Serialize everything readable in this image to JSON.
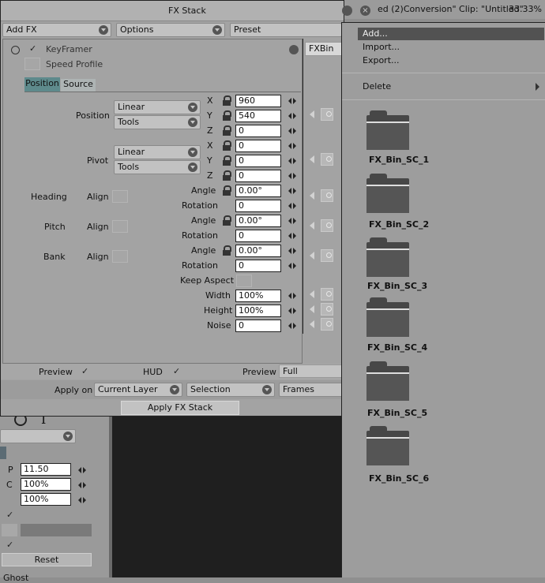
{
  "fx_stack": {
    "title": "FX Stack",
    "toolbar": {
      "add_fx": "Add FX",
      "options": "Options",
      "preset": "Preset"
    },
    "keyframer": {
      "name": "KeyFramer",
      "speed_profile": "Speed Profile",
      "tabs": [
        "Position",
        "Source"
      ],
      "position": {
        "label": "Position",
        "interp": "Linear",
        "tools": "Tools",
        "x": "960",
        "y": "540",
        "z": "0"
      },
      "pivot": {
        "label": "Pivot",
        "interp": "Linear",
        "tools": "Tools",
        "x": "0",
        "y": "0",
        "z": "0"
      },
      "axis": {
        "x": "X",
        "y": "Y",
        "z": "Z"
      },
      "heading": {
        "label": "Heading",
        "align": "Align",
        "angle": "0.00°",
        "rotation": "0"
      },
      "pitch": {
        "label": "Pitch",
        "align": "Align",
        "angle": "0.00°",
        "rotation": "0"
      },
      "bank": {
        "label": "Bank",
        "align": "Align",
        "angle": "0.00°",
        "rotation": "0"
      },
      "angle_label": "Angle",
      "rotation_label": "Rotation",
      "keep_aspect": "Keep Aspect",
      "width": {
        "label": "Width",
        "value": "100%"
      },
      "height": {
        "label": "Height",
        "value": "100%"
      },
      "noise": {
        "label": "Noise",
        "value": "0"
      }
    },
    "fxbin": "FXBin",
    "bottom": {
      "preview": "Preview",
      "hud": "HUD",
      "preview2": "Preview",
      "preview_mode": "Full",
      "apply_on": "Apply on",
      "layer": "Current Layer",
      "selection": "Selection",
      "frames": "Frames",
      "apply_button": "Apply FX Stack"
    }
  },
  "status": {
    "clip_text": "ed (2)Conversion\"  Clip: \"Untitled\"",
    "zoom": "33.33%"
  },
  "left_panel": {
    "p_label": "P",
    "p_value": "11.50",
    "c_label": "C",
    "c_value": "100%",
    "v_value": "100%",
    "reset": "Reset",
    "bottom_text": "Ghost"
  },
  "menu": {
    "items": [
      "Add...",
      "Import...",
      "Export..."
    ],
    "delete": "Delete",
    "bins": [
      "FX_Bin_SC_1",
      "FX_Bin_SC_2",
      "FX_Bin_SC_3",
      "FX_Bin_SC_4",
      "FX_Bin_SC_5",
      "FX_Bin_SC_6"
    ]
  }
}
